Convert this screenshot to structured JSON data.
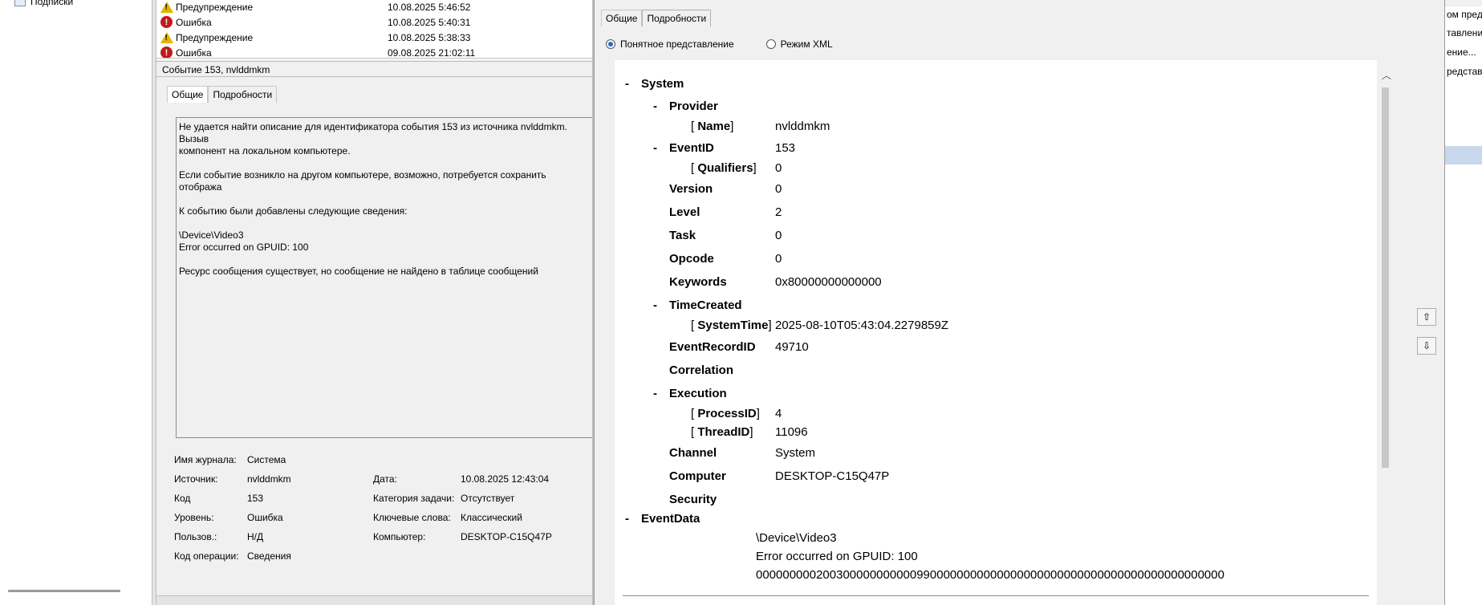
{
  "nav": {
    "tree_item": "Подписки"
  },
  "events": [
    {
      "level": "Предупреждение",
      "type": "warning",
      "date": "10.08.2025 5:46:52"
    },
    {
      "level": "Ошибка",
      "type": "error",
      "date": "10.08.2025 5:40:31"
    },
    {
      "level": "Предупреждение",
      "type": "warning",
      "date": "10.08.2025 5:38:33"
    },
    {
      "level": "Ошибка",
      "type": "error",
      "date": "09.08.2025 21:02:11"
    }
  ],
  "detail": {
    "header": "Событие 153, nvlddmkm",
    "tabs": [
      "Общие",
      "Подробности"
    ],
    "description": "Не удается найти описание для идентификатора события 153 из источника nvlddmkm. Вызыв\nкомпонент на локальном компьютере.\n\nЕсли событие возникло на другом компьютере, возможно, потребуется сохранить отобража\n\nК событию были добавлены следующие сведения:\n\n\\Device\\Video3\nError occurred on GPUID: 100\n\nРесурс сообщения существует, но сообщение не найдено в таблице сообщений",
    "props": {
      "journal_label": "Имя журнала:",
      "journal_value": "Система",
      "source_label": "Источник:",
      "source_value": "nvlddmkm",
      "date_label": "Дата:",
      "date_value": "10.08.2025 12:43:04",
      "code_label": "Код",
      "code_value": "153",
      "category_label": "Категория задачи:",
      "category_value": "Отсутствует",
      "level_label": "Уровень:",
      "level_value": "Ошибка",
      "keywords_label": "Ключевые слова:",
      "keywords_value": "Классический",
      "user_label": "Пользов.:",
      "user_value": "Н/Д",
      "computer_label": "Компьютер:",
      "computer_value": "DESKTOP-C15Q47P",
      "opcode_label": "Код операции:",
      "opcode_value": "Сведения"
    }
  },
  "dialog": {
    "tabs": [
      "Общие",
      "Подробности"
    ],
    "radio_friendly": "Понятное представление",
    "radio_xml": "Режим XML",
    "xml": {
      "minus": "-",
      "system": "System",
      "provider": "Provider",
      "name_key": "Name",
      "name_value": "nvlddmkm",
      "eventid_key": "EventID",
      "eventid_value": "153",
      "qualifiers_key": "Qualifiers",
      "qualifiers_value": "0",
      "version_key": "Version",
      "version_value": "0",
      "level_key": "Level",
      "level_value": "2",
      "task_key": "Task",
      "task_value": "0",
      "opcode_key": "Opcode",
      "opcode_value": "0",
      "keywords_key": "Keywords",
      "keywords_value": "0x80000000000000",
      "timecreated_key": "TimeCreated",
      "systemtime_key": "SystemTime",
      "systemtime_value": "2025-08-10T05:43:04.2279859Z",
      "recordid_key": "EventRecordID",
      "recordid_value": "49710",
      "correlation_key": "Correlation",
      "execution_key": "Execution",
      "processid_key": "ProcessID",
      "processid_value": "4",
      "threadid_key": "ThreadID",
      "threadid_value": "11096",
      "channel_key": "Channel",
      "channel_value": "System",
      "computer_key": "Computer",
      "computer_value": "DESKTOP-C15Q47P",
      "security_key": "Security",
      "eventdata_key": "EventData",
      "data_line1": "\\Device\\Video3",
      "data_line2": "Error occurred on GPUID: 100",
      "data_line3": "0000000002003000000000009900000000000000000000000000000000000000000000"
    }
  },
  "actions": [
    "ом пред",
    "тавление",
    "ение...",
    "редставле"
  ],
  "colors": {
    "warning": "#e3b400",
    "error": "#c21a1a",
    "selection": "#c7d8ec"
  }
}
